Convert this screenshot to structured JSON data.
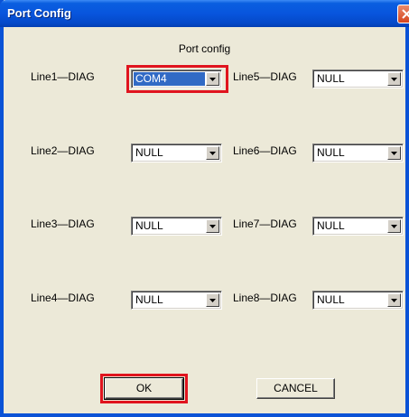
{
  "window": {
    "title": "Port Config"
  },
  "dialog": {
    "heading": "Port config",
    "lines": [
      {
        "label": "Line1—DIAG",
        "value": "COM4",
        "selected": true
      },
      {
        "label": "Line2—DIAG",
        "value": "NULL"
      },
      {
        "label": "Line3—DIAG",
        "value": "NULL"
      },
      {
        "label": "Line4—DIAG",
        "value": "NULL"
      },
      {
        "label": "Line5—DIAG",
        "value": "NULL"
      },
      {
        "label": "Line6—DIAG",
        "value": "NULL"
      },
      {
        "label": "Line7—DIAG",
        "value": "NULL"
      },
      {
        "label": "Line8—DIAG",
        "value": "NULL"
      }
    ],
    "ok_label": "OK",
    "cancel_label": "CANCEL"
  },
  "colors": {
    "titlebar": "#0a52d6",
    "dialog_bg": "#ece9d8",
    "selection": "#316ac5",
    "highlight": "#e0141e"
  }
}
